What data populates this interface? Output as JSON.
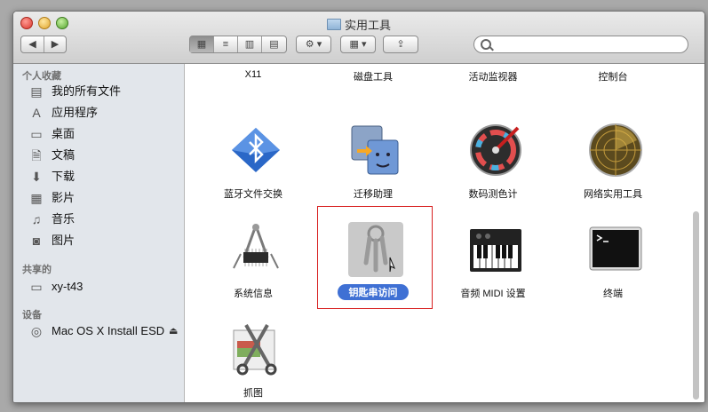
{
  "window": {
    "title": "实用工具"
  },
  "toolbar": {
    "search": {
      "value": "",
      "placeholder": ""
    }
  },
  "sidebar": {
    "sections": {
      "favorites": "个人收藏",
      "shared": "共享的",
      "devices": "设备"
    },
    "favorites": [
      {
        "label": "我的所有文件",
        "icon": "all-files-icon"
      },
      {
        "label": "应用程序",
        "icon": "applications-icon"
      },
      {
        "label": "桌面",
        "icon": "desktop-icon"
      },
      {
        "label": "文稿",
        "icon": "documents-icon"
      },
      {
        "label": "下载",
        "icon": "downloads-icon"
      },
      {
        "label": "影片",
        "icon": "movies-icon"
      },
      {
        "label": "音乐",
        "icon": "music-icon"
      },
      {
        "label": "图片",
        "icon": "pictures-icon"
      }
    ],
    "shared": [
      {
        "label": "xy-t43",
        "icon": "computer-icon"
      }
    ],
    "devices": [
      {
        "label": "Mac OS X Install ESD",
        "icon": "disk-icon"
      }
    ]
  },
  "content": {
    "top_row": [
      "X11",
      "磁盘工具",
      "活动监视器",
      "控制台"
    ],
    "items": [
      {
        "label": "蓝牙文件交换",
        "icon": "bluetooth-icon"
      },
      {
        "label": "迁移助理",
        "icon": "migration-icon"
      },
      {
        "label": "数码测色计",
        "icon": "colorimeter-icon"
      },
      {
        "label": "网络实用工具",
        "icon": "radar-icon"
      },
      {
        "label": "系统信息",
        "icon": "system-info-icon"
      },
      {
        "label": "钥匙串访问",
        "icon": "keychain-icon"
      },
      {
        "label": "音频 MIDI 设置",
        "icon": "midi-keyboard-icon"
      },
      {
        "label": "终端",
        "icon": "terminal-icon"
      },
      {
        "label": "抓图",
        "icon": "grab-icon"
      }
    ]
  }
}
